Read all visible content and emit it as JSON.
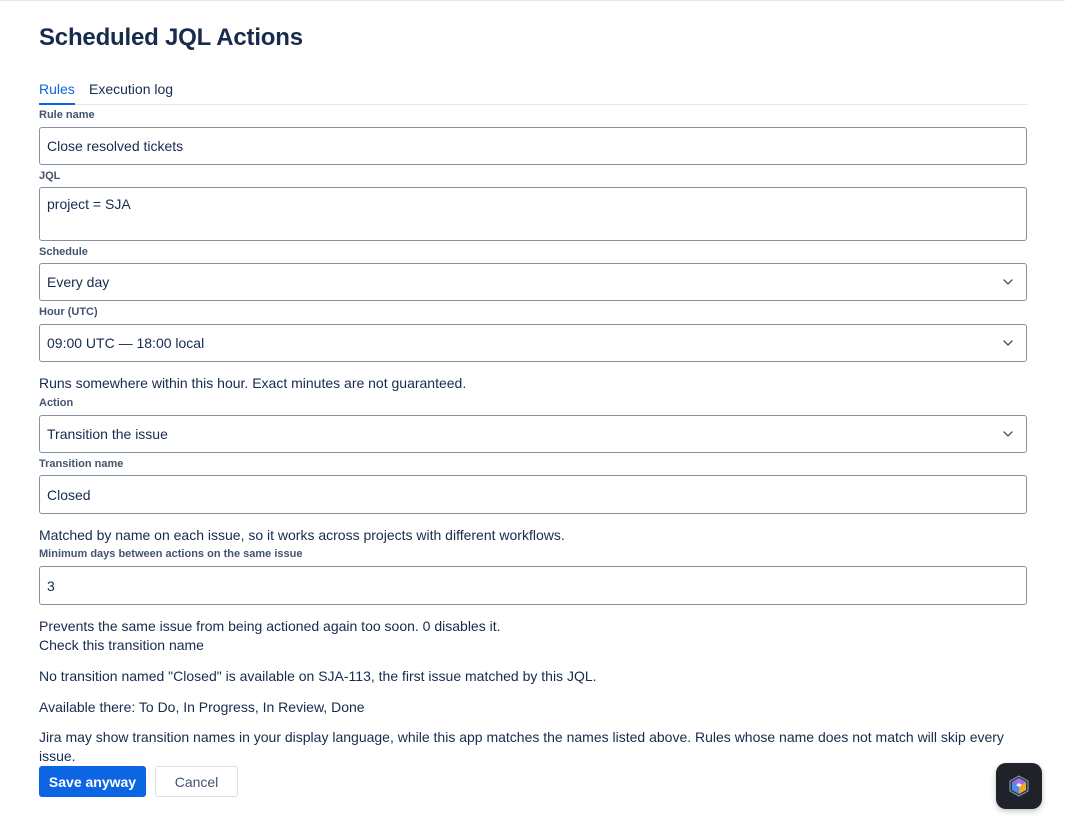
{
  "page": {
    "title": "Scheduled JQL Actions"
  },
  "tabs": [
    {
      "label": "Rules",
      "active": true
    },
    {
      "label": "Execution log",
      "active": false
    }
  ],
  "form": {
    "rule_name": {
      "label": "Rule name",
      "value": "Close resolved tickets"
    },
    "jql": {
      "label": "JQL",
      "value": "project = SJA"
    },
    "schedule": {
      "label": "Schedule",
      "value": "Every day"
    },
    "hour": {
      "label": "Hour (UTC)",
      "value": "09:00 UTC — 18:00 local",
      "help": "Runs somewhere within this hour. Exact minutes are not guaranteed."
    },
    "action": {
      "label": "Action",
      "value": "Transition the issue"
    },
    "transition": {
      "label": "Transition name",
      "value": "Closed",
      "help": "Matched by name on each issue, so it works across projects with different workflows."
    },
    "min_days": {
      "label": "Minimum days between actions on the same issue",
      "value": "3",
      "help": "Prevents the same issue from being actioned again too soon. 0 disables it."
    }
  },
  "warning": {
    "title": "Check this transition name",
    "message": "No transition named \"Closed\" is available on SJA-113, the first issue matched by this JQL.",
    "available": "Available there: To Do, In Progress, In Review, Done",
    "note": "Jira may show transition names in your display language, while this app matches the names listed above. Rules whose name does not match will skip every issue."
  },
  "actions": {
    "save_label": "Save anyway",
    "cancel_label": "Cancel"
  },
  "colors": {
    "accent": "#0c66e4",
    "text": "#172b4d",
    "border": "#8590a2"
  },
  "icons": {
    "select_chevron": "chevron-down-icon",
    "assistant": "app-assistant-icon"
  }
}
